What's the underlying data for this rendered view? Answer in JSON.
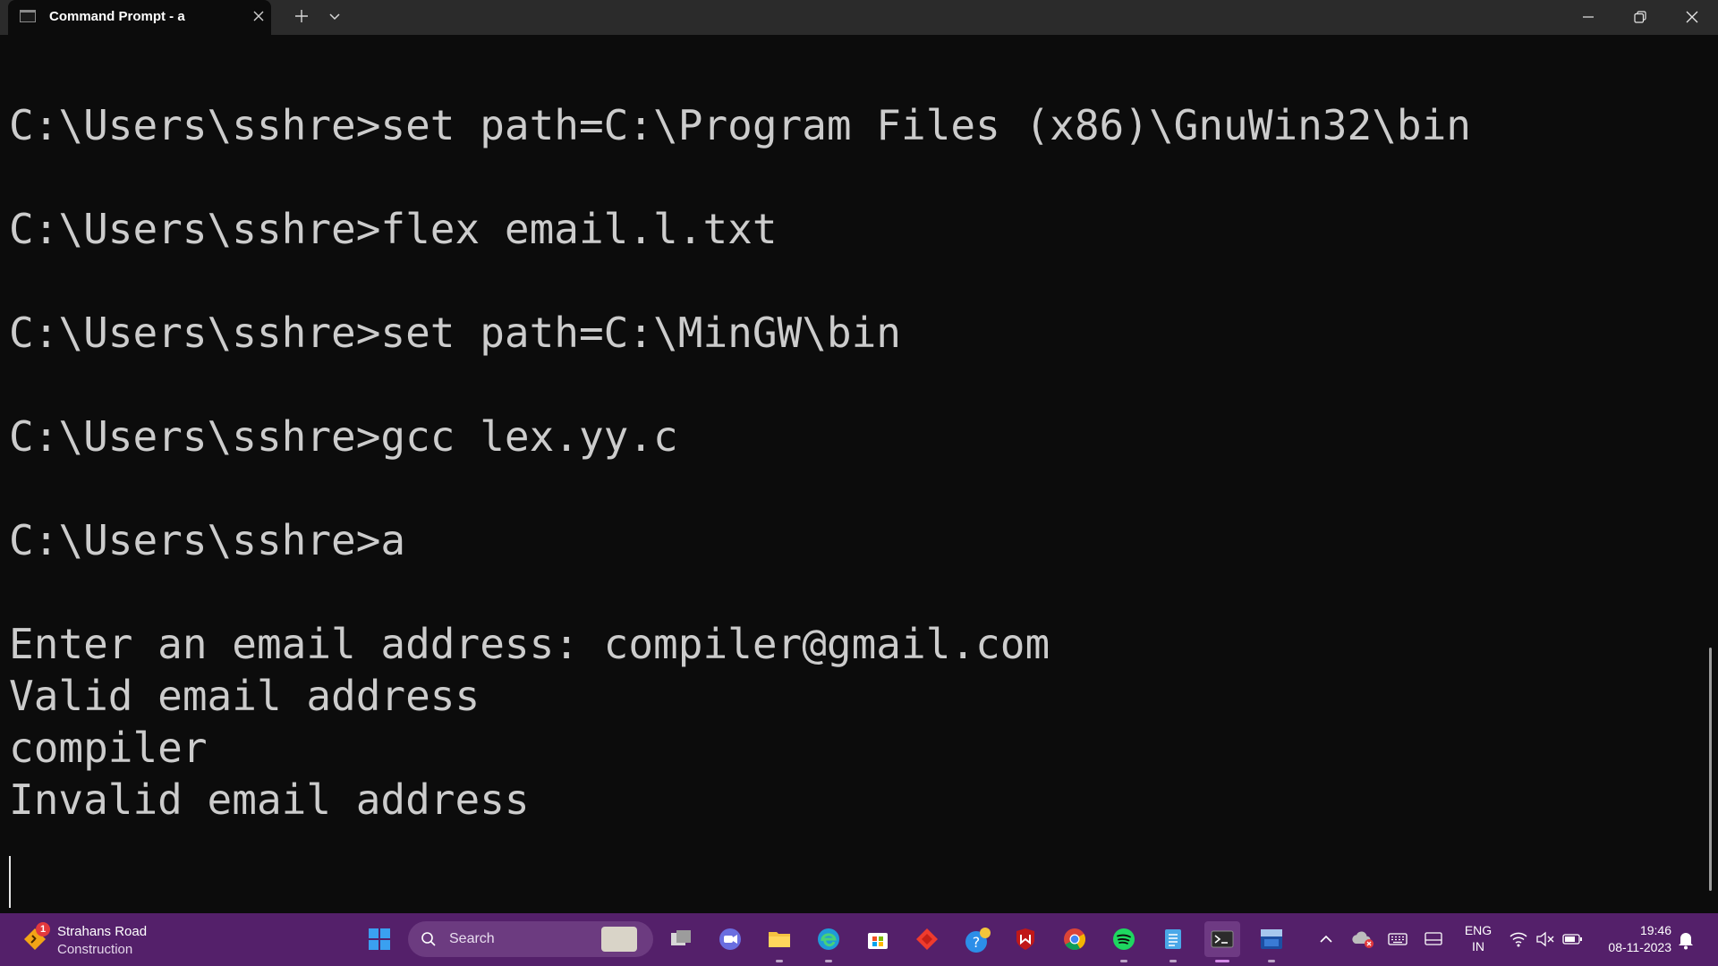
{
  "window": {
    "tab_title": "Command Prompt - a",
    "tab_icon": "console-icon",
    "close_tab_icon": "close-icon",
    "new_tab_icon": "plus-icon",
    "dropdown_icon": "chevron-down-icon",
    "controls": [
      "minimize-icon",
      "restore-icon",
      "close-icon"
    ]
  },
  "terminal": {
    "lines": [
      "C:\\Users\\sshre>set path=C:\\Program Files (x86)\\GnuWin32\\bin",
      "C:\\Users\\sshre>flex email.l.txt",
      "C:\\Users\\sshre>set path=C:\\MinGW\\bin",
      "C:\\Users\\sshre>gcc lex.yy.c",
      "C:\\Users\\sshre>a",
      "Enter an email address: compiler@gmail.com",
      "Valid email address",
      "compiler",
      "Invalid email address"
    ],
    "colors": {
      "background": "#0c0c0c",
      "foreground": "#cccccc"
    }
  },
  "taskbar": {
    "weather": {
      "title": "Strahans Road",
      "subtitle": "Construction",
      "badge": "1",
      "icon": "traffic-alert-icon"
    },
    "search": {
      "label": "Search",
      "icon": "search-icon"
    },
    "apps": [
      "windows-start-icon",
      "task-view-icon",
      "teams-chat-icon",
      "file-explorer-icon",
      "edge-icon",
      "microsoft-store-icon",
      "anydesk-icon",
      "help-icon",
      "mcafee-icon",
      "chrome-icon",
      "spotify-icon",
      "notepad-icon",
      "terminal-icon",
      "dev-cpp-icon"
    ],
    "tray": {
      "language_line1": "ENG",
      "language_line2": "IN",
      "time": "19:46",
      "date": "08-11-2023"
    },
    "accent": "#54206a"
  }
}
